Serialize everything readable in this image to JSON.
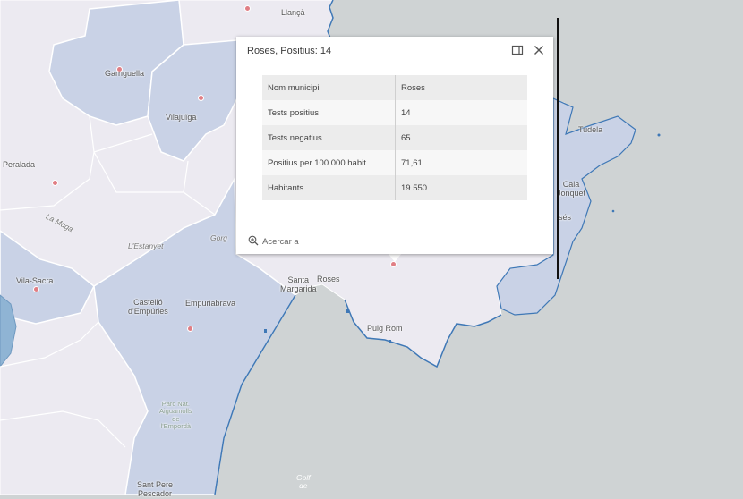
{
  "map": {
    "places": {
      "llanca": "Llançà",
      "garriguella": "Garriguella",
      "vilajuiga": "Vilajuïga",
      "peralada": "Peralada",
      "la_muga": "La Muga",
      "lestanyet": "L'Estanyet",
      "gorg": "Gorg",
      "vila_sacra": "Vila-Sacra",
      "castello_1": "Castelló",
      "castello_2": "d'Empúries",
      "empuriabrava": "Empuriabrava",
      "santa_margarida_1": "Santa",
      "santa_margarida_2": "Margarida",
      "roses": "Roses",
      "puig_rom": "Puig Rom",
      "tudela": "Tudela",
      "cala_1": "Cala",
      "cala_2": "Jonquet",
      "ses": "sés",
      "parc_1": "Parc Nat.",
      "parc_2": "Aiguamolls",
      "parc_3": "de",
      "parc_4": "l'Empordà",
      "sant_pere_1": "Sant Pere",
      "sant_pere_2": "Pescador",
      "golf_1": "Golf",
      "golf_2": "de"
    },
    "colors": {
      "sea": "#cfd3d4",
      "land_light": "#eceaf1",
      "region_blue": "#c9d2e6",
      "coast_blue": "#3f78b6",
      "marker_red": "#e07e84"
    }
  },
  "popup": {
    "title": "Roses, Positius: 14",
    "dock_icon": "dock-icon",
    "close_icon": "close-icon",
    "rows": [
      {
        "key": "Nom municipi",
        "value": "Roses"
      },
      {
        "key": "Tests positius",
        "value": "14"
      },
      {
        "key": "Tests negatius",
        "value": "65"
      },
      {
        "key": "Positius per 100.000 habit.",
        "value": "71,61"
      },
      {
        "key": "Habitants",
        "value": "19.550"
      }
    ],
    "zoom_icon": "zoom-in-icon",
    "zoom_label": "Acercar a"
  }
}
